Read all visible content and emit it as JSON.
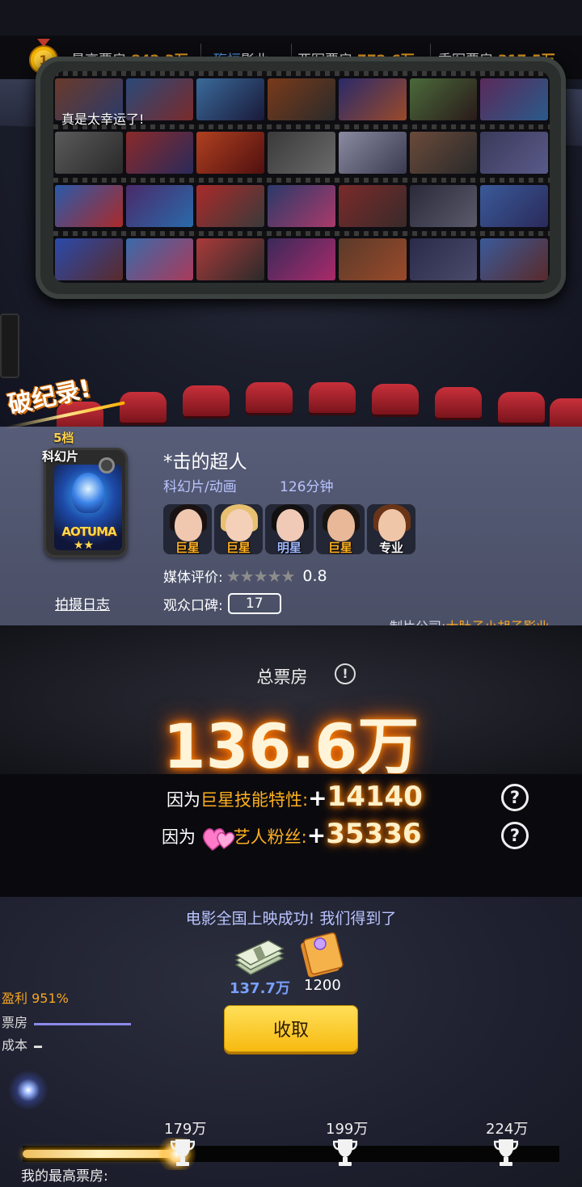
{
  "top_bar": {
    "highest_label": "最高票房",
    "highest_value": "842.3万",
    "company_name_hl": "殇恒",
    "company_name_rest": "影业",
    "second_label": "亚军票房",
    "second_value": "772.6万",
    "third_label": "季军票房",
    "third_value": "317.5万"
  },
  "screen": {
    "caption": "真是太幸运了!"
  },
  "record": {
    "badge": "破纪录!"
  },
  "movie": {
    "tier": "5档",
    "genre_tag": "科幻片",
    "poster_title": "AOTUMA",
    "poster_stars": "★★",
    "title": "*击的超人",
    "genres": "科幻片/动画",
    "duration": "126分钟",
    "log_link": "拍摄日志",
    "cast": [
      {
        "role": "巨星",
        "role_color": "#ffb020"
      },
      {
        "role": "巨星",
        "role_color": "#ffb020"
      },
      {
        "role": "明星",
        "role_color": "#9fb6ff"
      },
      {
        "role": "巨星",
        "role_color": "#ffb020"
      },
      {
        "role": "专业",
        "role_color": "#ffffff"
      }
    ],
    "media_rating_label": "媒体评价:",
    "media_rating_value": "0.8",
    "media_stars_filled": 0.16,
    "word_of_mouth_label": "观众口碑:",
    "word_of_mouth_value": "17",
    "studio_label": "制片公司:",
    "studio_name": "大肚子小胡子影业"
  },
  "box_office": {
    "label": "总票房",
    "value": "136.6万",
    "bonus1_prefix": "因为",
    "bonus1_hl": "巨星",
    "bonus1_suffix": "技能特性:",
    "bonus1_value": "14140",
    "bonus2_prefix": "因为",
    "bonus2_suffix": "艺人粉丝:",
    "bonus2_value": "35336"
  },
  "rewards": {
    "release_text": "电影全国上映成功! 我们得到了",
    "money_value": "137.7万",
    "ticket_value": "1200",
    "profit": "盈利 951%",
    "revenue_label": "票房",
    "cost_label": "成本",
    "collect_label": "收取"
  },
  "progress": {
    "milestones": [
      "179万",
      "199万",
      "224万"
    ],
    "my_best_label": "我的最高票房:",
    "fill_fraction": 0.29
  },
  "colors": {
    "accent_orange": "#f6a623",
    "accent_blue": "#b9c4ff",
    "button_yellow": "#ffd23a"
  }
}
